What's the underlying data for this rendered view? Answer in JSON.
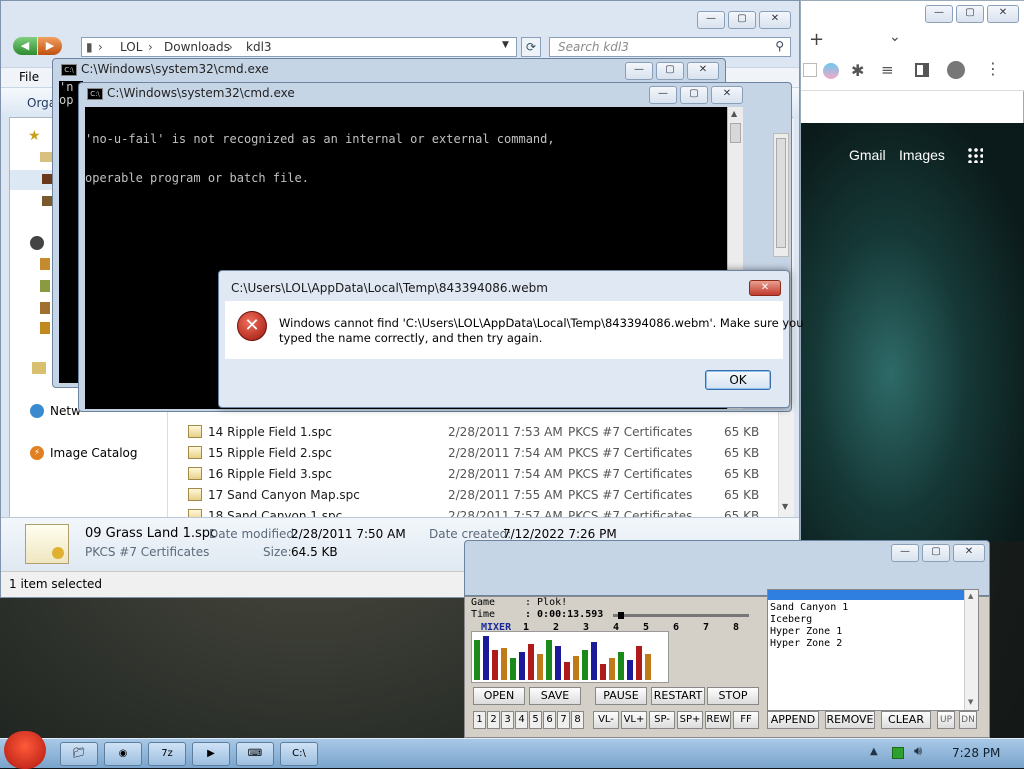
{
  "explorer": {
    "breadcrumb": [
      "LOL",
      "Downloads",
      "kdl3"
    ],
    "search_placeholder": "Search kdl3",
    "menu_file": "File",
    "organize_label": "Orga",
    "nav_items": [
      "Netw",
      "Image Catalog"
    ],
    "files": [
      {
        "name": "14 Ripple Field 1.spc",
        "date": "2/28/2011 7:53 AM",
        "type": "PKCS #7 Certificates",
        "size": "65 KB"
      },
      {
        "name": "15 Ripple Field 2.spc",
        "date": "2/28/2011 7:54 AM",
        "type": "PKCS #7 Certificates",
        "size": "65 KB"
      },
      {
        "name": "16 Ripple Field 3.spc",
        "date": "2/28/2011 7:54 AM",
        "type": "PKCS #7 Certificates",
        "size": "65 KB"
      },
      {
        "name": "17 Sand Canyon Map.spc",
        "date": "2/28/2011 7:55 AM",
        "type": "PKCS #7 Certificates",
        "size": "65 KB"
      },
      {
        "name": "18 Sand Canyon 1.spc",
        "date": "2/28/2011 7:57 AM",
        "type": "PKCS #7 Certificates",
        "size": "65 KB"
      }
    ],
    "details": {
      "filename": "09 Grass Land 1.spc",
      "modified_label": "Date modified:",
      "modified": "2/28/2011 7:50 AM",
      "created_label": "Date created:",
      "created": "7/12/2022 7:26 PM",
      "type": "PKCS #7 Certificates",
      "size_label": "Size:",
      "size": "64.5 KB"
    },
    "status": "1 item selected"
  },
  "cmd_back": {
    "title": "C:\\Windows\\system32\\cmd.exe",
    "line1": "'n",
    "line2": "op"
  },
  "cmd_front": {
    "title": "C:\\Windows\\system32\\cmd.exe",
    "line1": "'no-u-fail' is not recognized as an internal or external command,",
    "line2": "operable program or batch file."
  },
  "dialog": {
    "title": "C:\\Users\\LOL\\AppData\\Local\\Temp\\843394086.webm",
    "message_line1": "Windows cannot find 'C:\\Users\\LOL\\AppData\\Local\\Temp\\843394086.webm'. Make sure you",
    "message_line2": "typed the name correctly, and then try again.",
    "ok_label": "OK",
    "close_label": "✕"
  },
  "chrome": {
    "gmail": "Gmail",
    "images": "Images",
    "new_tab": "+"
  },
  "player": {
    "game_label": "Game",
    "game_value": ": Plok!",
    "time_label": "Time",
    "time_value": ": 0:00:13.593",
    "mixer_label": "MIXER",
    "channels": [
      "1",
      "2",
      "3",
      "4",
      "5",
      "6",
      "7",
      "8"
    ],
    "progress": 0.04,
    "buttons_row1": [
      "OPEN",
      "SAVE",
      "PAUSE",
      "RESTART",
      "STOP"
    ],
    "num_buttons": [
      "1",
      "2",
      "3",
      "4",
      "5",
      "6",
      "7",
      "8"
    ],
    "buttons_row2": [
      "VL-",
      "VL+",
      "SP-",
      "SP+",
      "REW",
      "FF"
    ],
    "playlist": [
      "Sand Canyon 1",
      "Iceberg",
      "Hyper Zone 1",
      "Hyper Zone 2"
    ],
    "playlist_buttons": [
      "APPEND",
      "REMOVE",
      "CLEAR",
      "UP",
      "DN"
    ]
  },
  "taskbar": {
    "clock": "7:28 PM",
    "tasks": [
      "folder",
      "chrome",
      "7z",
      "media",
      "keyboard",
      "cmd"
    ]
  },
  "colors": {
    "error_red": "#c0392b",
    "cmd_black": "#000000",
    "playlist_highlight": "#2f7fe0",
    "taskbar": "#8fb6dc"
  }
}
